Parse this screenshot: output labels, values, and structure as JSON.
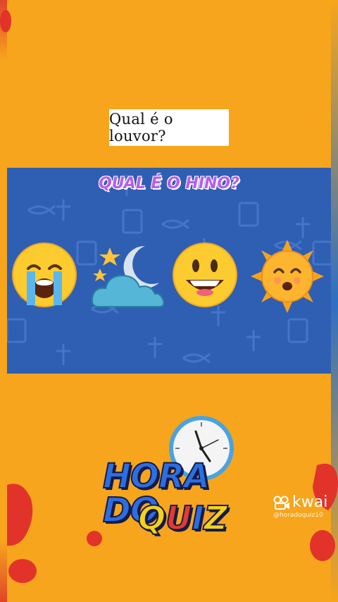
{
  "prompt_card": {
    "text": "Qual é o louvor?"
  },
  "panel": {
    "heading": "QUAL É O HINO?",
    "emojis": [
      "crying-face",
      "crescent-moon-cloud-stars",
      "grinning-face",
      "smiling-sun"
    ],
    "background_color": "#2f5fb3"
  },
  "logo": {
    "line1": "HORA DO",
    "line2_letters": [
      "Q",
      "U",
      "I",
      "Z"
    ],
    "line2_colors": [
      "#f5d21a",
      "#e23b2e",
      "#2b6fe0",
      "#f5d21a"
    ]
  },
  "watermark": {
    "brand": "kwai",
    "handle": "@horadoquiz10"
  },
  "colors": {
    "background": "#f6a51c",
    "accent_purple": "#b85cf0",
    "accent_red": "#e23b2e"
  }
}
